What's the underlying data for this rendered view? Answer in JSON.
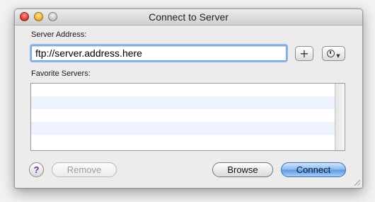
{
  "window": {
    "title": "Connect to Server"
  },
  "server_address": {
    "label": "Server Address:",
    "value": "ftp://server.address.here"
  },
  "buttons": {
    "add_label": "+",
    "help_label": "?",
    "remove_label": "Remove",
    "browse_label": "Browse",
    "connect_label": "Connect"
  },
  "favorites": {
    "label": "Favorite Servers:",
    "items": []
  },
  "colors": {
    "focus_ring": "#8ab6ea",
    "default_button": "#6ea6ea",
    "list_stripe": "#edf3fe"
  }
}
